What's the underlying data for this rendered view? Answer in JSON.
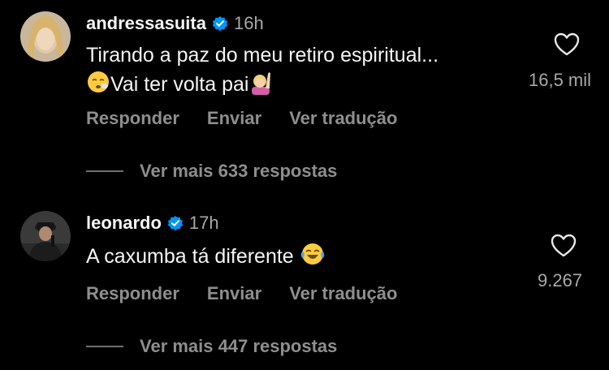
{
  "comments": [
    {
      "username": "andressasuita",
      "time": "16h",
      "text_line1": "Tirando a paz do meu retiro espiritual...",
      "text_line2": "Vai ter volta pai",
      "emojis": [
        "sleepy-face-emoji",
        "person-raising-hand-emoji"
      ],
      "likes": "16,5 mil",
      "actions": [
        "Responder",
        "Enviar",
        "Ver tradução"
      ],
      "replies": "Ver mais 633 respostas"
    },
    {
      "username": "leonardo",
      "time": "17h",
      "text_line1": "A caxumba tá diferente",
      "emojis": [
        "tears-of-joy-emoji"
      ],
      "likes": "9.267",
      "actions": [
        "Responder",
        "Enviar",
        "Ver tradução"
      ],
      "replies": "Ver mais 447 respostas"
    }
  ],
  "colors": {
    "background": "#000000",
    "text": "#f5f5f5",
    "secondary": "#8e8e8e",
    "verified": "#0095f6"
  }
}
